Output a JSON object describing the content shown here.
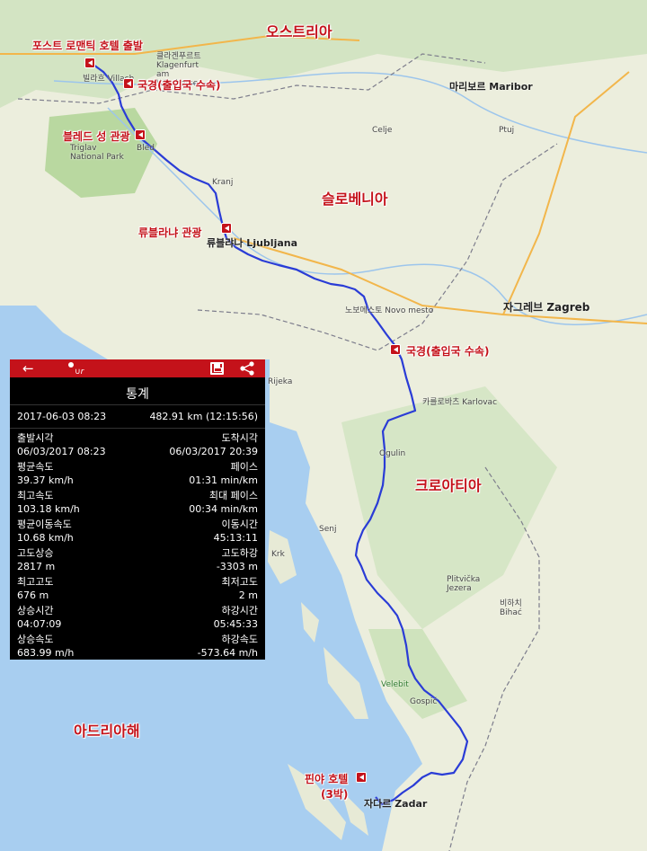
{
  "map": {
    "annotations": [
      {
        "id": "hotel-start",
        "text": "포스트 로맨틱 호텔 출발"
      },
      {
        "id": "border1",
        "text": "국경(출입국 수속)"
      },
      {
        "id": "bled",
        "text": "블레드 성 관광"
      },
      {
        "id": "ljubljana",
        "text": "류블라냐 관광"
      },
      {
        "id": "border2",
        "text": "국경(출입국 수속)"
      },
      {
        "id": "hotel-end-1",
        "text": "핀야 호텔"
      },
      {
        "id": "hotel-end-2",
        "text": "(3박)"
      }
    ],
    "regions": {
      "austria": "오스트리아",
      "slovenia": "슬로베니아",
      "croatia": "크로아티아",
      "adriatic": "아드리아해"
    },
    "places": {
      "villach": "빌라흐 Villach",
      "klagenfurt": "클라겐푸르트 Klagenfurt am Wörthersee",
      "ljubljana_city": "류블랴나 Ljubljana",
      "maribor": "마리보르 Maribor",
      "zagreb": "자그레브 Zagreb",
      "karlovac": "카를로바츠 Karlovac",
      "novo_mesto": "노보메스토 Novo mesto",
      "zadar": "자다르 Zadar",
      "kranj": "Kranj",
      "bled": "Bled",
      "triglav": "Triglav National Park",
      "velebit": "Velebit",
      "rijeka": "Rijeka",
      "ogulin": "Ogulin",
      "gospic": "Gospić",
      "senj": "Senj",
      "krk": "Krk",
      "plitvice": "Plitvička Jezera",
      "bihac": "비하치 Bihać",
      "celje": "Celje",
      "ptuj": "Ptuj"
    }
  },
  "panel": {
    "title": "통계",
    "summary": {
      "datetime": "2017-06-03 08:23",
      "distance": "482.91 km (12:15:56)"
    },
    "stats": [
      {
        "left_label": "출발시각",
        "left_value": "06/03/2017 08:23",
        "right_label": "도착시각",
        "right_value": "06/03/2017 20:39"
      },
      {
        "left_label": "평균속도",
        "left_value": "39.37 km/h",
        "right_label": "페이스",
        "right_value": "01:31 min/km"
      },
      {
        "left_label": "최고속도",
        "left_value": "103.18 km/h",
        "right_label": "최대 페이스",
        "right_value": "00:34 min/km"
      },
      {
        "left_label": "평균이동속도",
        "left_value": "10.68 km/h",
        "right_label": "이동시간",
        "right_value": "45:13:11"
      },
      {
        "left_label": "고도상승",
        "left_value": "2817 m",
        "right_label": "고도하강",
        "right_value": "-3303 m"
      },
      {
        "left_label": "최고고도",
        "left_value": "676 m",
        "right_label": "최저고도",
        "right_value": "2 m"
      },
      {
        "left_label": "상승시간",
        "left_value": "04:07:09",
        "right_label": "하강시간",
        "right_value": "05:45:33"
      },
      {
        "left_label": "상승속도",
        "left_value": "683.99 m/h",
        "right_label": "하강속도",
        "right_value": "-573.64 m/h"
      }
    ],
    "icons": [
      "back-arrow-icon",
      "app-logo-icon",
      "save-icon",
      "share-icon"
    ]
  },
  "colors": {
    "accent": "#c4121a",
    "route": "#2a3cd6",
    "sea": "#a8cef0",
    "land": "#e9ecd9"
  }
}
